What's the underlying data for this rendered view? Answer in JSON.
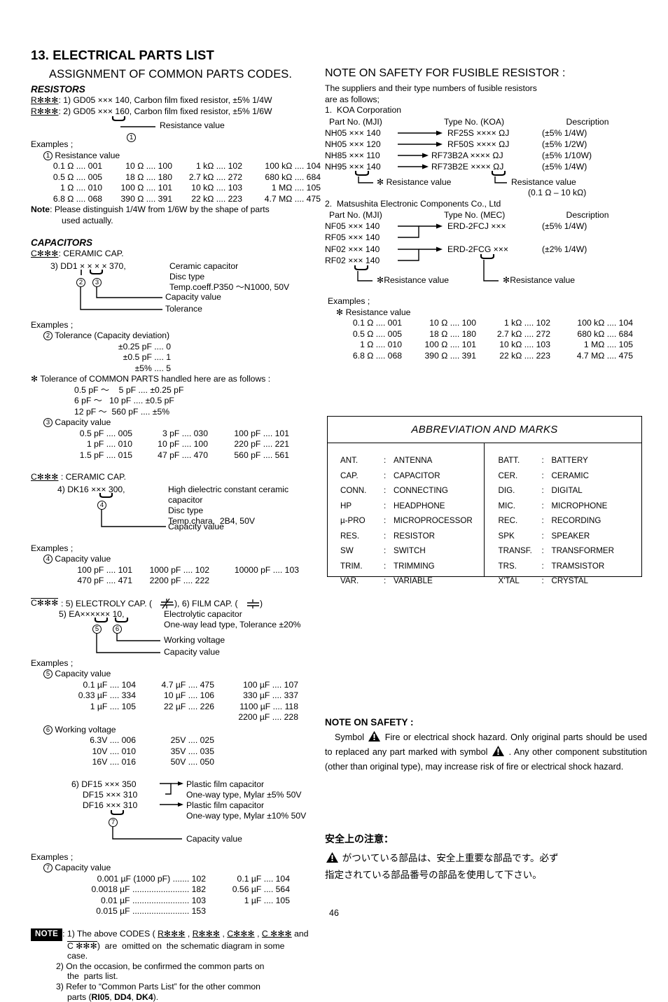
{
  "page_number": "46",
  "left": {
    "title": "13. ELECTRICAL PARTS LIST",
    "subtitle": "ASSIGNMENT OF COMMON PARTS CODES.",
    "resistors": {
      "heading": "RESISTORS",
      "code1_prefix": "R",
      "code1_stars": "✻✻✻",
      "line1": ": 1) GD05 ××× 140, Carbon film fixed resistor, ±5% 1/4W",
      "line2": ": 2) GD05 ××× 160, Carbon film fixed resistor, ±5% 1/6W",
      "callout1_label": "Resistance value",
      "examples_label": "Examples ;",
      "ex1_title": "Resistance value",
      "ex1_rows": [
        [
          "0.1 Ω .... 001",
          "10 Ω .... 100",
          "1 kΩ .... 102",
          "100 kΩ .... 104"
        ],
        [
          "0.5 Ω .... 005",
          "18 Ω .... 180",
          "2.7 kΩ .... 272",
          "680 kΩ .... 684"
        ],
        [
          "1 Ω .... 010",
          "100 Ω .... 101",
          "10 kΩ .... 103",
          "1 MΩ .... 105"
        ],
        [
          "6.8 Ω .... 068",
          "390 Ω .... 391",
          "22 kΩ .... 223",
          "4.7 MΩ .... 475"
        ]
      ],
      "note_label": "Note",
      "note_text": ": Please distinguish 1/4W from 1/6W by the shape of parts",
      "note_text2": "used actually."
    },
    "capacitors": {
      "heading": "CAPACITORS",
      "c1_code": "C✻✻✻",
      "c1_type": ": CERAMIC CAP.",
      "c1_line": "3) DD1 × × × × 370,",
      "c1_desc1": "Ceramic capacitor",
      "c1_desc2": "Disc type",
      "c1_desc3": "Temp.coeff.P350 〜N1000, 50V",
      "c1_callout_cap": "Capacity value",
      "c1_callout_tol": "Tolerance",
      "examples_label": "Examples ;",
      "ex2_title": "Tolerance (Capacity deviation)",
      "ex2_rows": [
        "±0.25 pF .... 0",
        "±0.5 pF .... 1",
        "±5% .... 5"
      ],
      "tol_note": "✻ Tolerance of COMMON PARTS handled here are as follows :",
      "tol_rows": [
        "0.5 pF 〜    5 pF .... ±0.25 pF",
        "6 pF 〜   10 pF .... ±0.5 pF",
        "12 pF 〜  560 pF .... ±5%"
      ],
      "ex3_title": "Capacity value",
      "ex3_rows": [
        [
          "0.5 pF .... 005",
          "3 pF .... 030",
          "100 pF .... 101"
        ],
        [
          "1 pF .... 010",
          "10 pF .... 100",
          "220 pF .... 221"
        ],
        [
          "1.5 pF .... 015",
          "47 pF .... 470",
          "560 pF .... 561"
        ]
      ],
      "c2_code": "C✻✻✻",
      "c2_type": ": CERAMIC CAP.",
      "c2_line": "4) DK16 ××× 300,",
      "c2_desc1": "High dielectric constant ceramic",
      "c2_desc2": "capacitor",
      "c2_desc3": "Disc type",
      "c2_desc4": "Temp.chara.  2B4, 50V",
      "c2_callout_cap": "Capacity value",
      "ex4_title": "Capacity value",
      "ex4_rows": [
        [
          "100 pF .... 101",
          "1000 pF .... 102",
          "10000 pF .... 103"
        ],
        [
          "470 pF .... 471",
          "2200 pF .... 222",
          ""
        ]
      ],
      "c3_code": "C✻✻✻",
      "c3_line": ": 5) ELECTROLY CAP. (       ), 6) FILM CAP. (      )",
      "c3_line_a": ": 5) ELECTROLY CAP. (",
      "c3_line_b": "), 6) FILM CAP. (",
      "c3_line_c": ")",
      "c3_sub": "5) EA×××××× 10,",
      "c3_desc1": "Electrolytic capacitor",
      "c3_desc2": "One-way lead type, Tolerance ±20%",
      "c3_callout_wv": "Working voltage",
      "c3_callout_cap": "Capacity value",
      "ex5_title": "Capacity value",
      "ex5_rows": [
        [
          "0.1 µF .... 104",
          "4.7 µF .... 475",
          "100 µF .... 107"
        ],
        [
          "0.33 µF .... 334",
          "10 µF .... 106",
          "330 µF .... 337"
        ],
        [
          "1 µF .... 105",
          "22 µF .... 226",
          "1100 µF .... 118"
        ],
        [
          "",
          "",
          "2200 µF .... 228"
        ]
      ],
      "ex6_title": "Working voltage",
      "ex6_rows": [
        [
          "6.3V .... 006",
          "25V .... 025"
        ],
        [
          "10V .... 010",
          "35V .... 035"
        ],
        [
          "16V .... 016",
          "50V .... 050"
        ]
      ],
      "film_l1": "6) DF15 ××× 350",
      "film_l2": "DF15 ××× 310",
      "film_l3": "DF16 ××× 310",
      "film_d1": "Plastic film capacitor",
      "film_d2": "One-way type, Mylar ±5% 50V",
      "film_d3": "Plastic film capacitor",
      "film_d4": "One-way type, Mylar ±10% 50V",
      "film_callout_cap": "Capacity value",
      "ex7_title": "Capacity value",
      "ex7_rows": [
        [
          "0.001 µF (1000 pF) ....... 102",
          "0.1 µF .... 104"
        ],
        [
          "0.0018 µF ........................ 182",
          "0.56 µF .... 564"
        ],
        [
          "0.01 µF ........................ 103",
          "1 µF .... 105"
        ],
        [
          "0.015 µF ........................ 153",
          ""
        ]
      ]
    },
    "note_block": {
      "badge": "NOTE",
      "item1_a": ": 1) The above CODES (",
      "item1_codes": [
        "R✻✻✻",
        "R✻✻✻",
        "C✻✻✻",
        "C ✻✻✻"
      ],
      "item1_b": "and",
      "item1_c": "C ✻✻✻",
      "item1_d": ")  are  omitted on  the schematic diagram in some",
      "item1_e": "case.",
      "item2_a": "2) On the occasion, be confirmed the common parts on",
      "item2_b": "the  parts list.",
      "item3_a": "3) Refer to “Common Parts List” for the other common",
      "item3_b": "parts (",
      "item3_bold1": "RI05",
      "item3_bold2": "DD4",
      "item3_bold3": "DK4",
      "item3_c": ")."
    }
  },
  "right": {
    "fusible": {
      "title": "NOTE ON SAFETY FOR FUSIBLE RESISTOR :",
      "intro1": "The suppliers and their type numbers of fusible resistors",
      "intro2": "are as follows;",
      "supplier1": "1.  KOA Corporation",
      "headers1": [
        "Part No. (MJI)",
        "Type No. (KOA)",
        "Description"
      ],
      "rows1": [
        {
          "part": "NH05 ××× 140",
          "type": "RF25S ×××× ΩJ",
          "desc": "(±5% 1/4W)"
        },
        {
          "part": "NH05 ××× 120",
          "type": "RF50S ×××× ΩJ",
          "desc": "(±5% 1/2W)"
        },
        {
          "part": "NH85 ××× 110",
          "type": "RF73B2A ×××× ΩJ",
          "desc": "(±5% 1/10W)"
        },
        {
          "part": "NH95 ××× 140",
          "type": "RF73B2E ×××× ΩJ",
          "desc": "(±5% 1/4W)"
        }
      ],
      "callout_left1": "✻ Resistance value",
      "callout_right1": "Resistance value",
      "callout_right1b": "(0.1 Ω – 10 kΩ)",
      "supplier2": "2.  Matsushita Electronic Components Co., Ltd",
      "headers2": [
        "Part No. (MJI)",
        "Type No. (MEC)",
        "Description"
      ],
      "rows2": [
        {
          "part": "NF05 ××× 140"
        },
        {
          "part": "RF05 ××× 140"
        },
        {
          "part": "NF02 ××× 140"
        },
        {
          "part": "RF02 ××× 140"
        }
      ],
      "type2a": "ERD-2FCJ ×××",
      "desc2a": "(±5% 1/4W)",
      "type2b": "ERD-2FCG ×××",
      "desc2b": "(±2% 1/4W)",
      "callout_left2": "✻Resistance value",
      "callout_right2": "✻Resistance value",
      "examples_label": "Examples ;",
      "ex_title": "✻ Resistance value",
      "ex_rows": [
        [
          "0.1 Ω .... 001",
          "10 Ω .... 100",
          "1 kΩ .... 102",
          "100 kΩ .... 104"
        ],
        [
          "0.5 Ω .... 005",
          "18 Ω .... 180",
          "2.7 kΩ .... 272",
          "680 kΩ .... 684"
        ],
        [
          "1 Ω .... 010",
          "100 Ω .... 101",
          "10 kΩ .... 103",
          "1 MΩ .... 105"
        ],
        [
          "6.8 Ω .... 068",
          "390 Ω .... 391",
          "22 kΩ .... 223",
          "4.7 MΩ .... 475"
        ]
      ]
    },
    "abbreviation": {
      "title": "ABBREVIATION AND MARKS",
      "left_items": [
        {
          "key": "ANT.",
          "val": "ANTENNA"
        },
        {
          "key": "CAP.",
          "val": "CAPACITOR"
        },
        {
          "key": "CONN.",
          "val": "CONNECTING"
        },
        {
          "key": "HP",
          "val": "HEADPHONE"
        },
        {
          "key": "µ-PRO",
          "val": "MICROPROCESSOR"
        },
        {
          "key": "RES.",
          "val": "RESISTOR"
        },
        {
          "key": "SW",
          "val": "SWITCH"
        },
        {
          "key": "TRIM.",
          "val": "TRIMMING"
        },
        {
          "key": "VAR.",
          "val": "VARIABLE"
        }
      ],
      "right_items": [
        {
          "key": "BATT.",
          "val": "BATTERY"
        },
        {
          "key": "CER.",
          "val": "CERAMIC"
        },
        {
          "key": "DIG.",
          "val": "DIGITAL"
        },
        {
          "key": "MIC.",
          "val": "MICROPHONE"
        },
        {
          "key": "REC.",
          "val": "RECORDING"
        },
        {
          "key": "SPK",
          "val": "SPEAKER"
        },
        {
          "key": "TRANSF.",
          "val": "TRANSFORMER"
        },
        {
          "key": "TRS.",
          "val": "TRAMSISTOR"
        },
        {
          "key": "X'TAL",
          "val": "CRYSTAL"
        }
      ],
      "separator": ":"
    },
    "safety": {
      "title": "NOTE ON SAFETY :",
      "text_a": "Symbol",
      "text_b": "Fire or electrical shock hazard. Only original parts should be used to replaced any part marked with symbol",
      "text_c": ". Any other component substitution (other than original type), may increase risk of fire or electrical shock hazard."
    },
    "safety_jp": {
      "title": "安全上の注意：",
      "line1": "がついている部品は、安全上重要な部品です。必ず",
      "line2": "指定されている部品番号の部品を使用して下さい。"
    }
  }
}
